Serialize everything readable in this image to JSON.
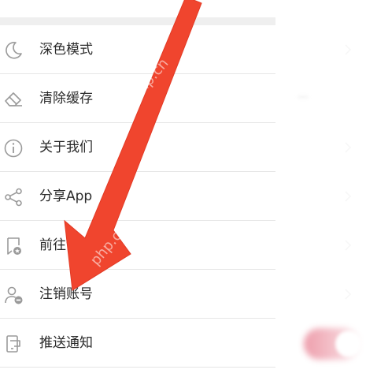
{
  "settings": {
    "items": [
      {
        "label": "深色模式",
        "icon": "moon-icon"
      },
      {
        "label": "清除缓存",
        "icon": "eraser-icon",
        "value": "—"
      },
      {
        "label": "关于我们",
        "icon": "info-icon"
      },
      {
        "label": "分享App",
        "icon": "share-icon"
      },
      {
        "label": "前往评",
        "icon": "bookmark-star-icon"
      },
      {
        "label": "注销账号",
        "icon": "user-remove-icon"
      },
      {
        "label": "推送通知",
        "icon": "phone-notify-icon",
        "toggle": true
      }
    ]
  },
  "overlay": {
    "arrow_color": "#f0452e",
    "watermark": "php.cn"
  },
  "colors": {
    "divider": "#e6e6e6",
    "text": "#2a2a2a",
    "icon": "#9a9a9a",
    "toggle_on": "#e3647a"
  }
}
